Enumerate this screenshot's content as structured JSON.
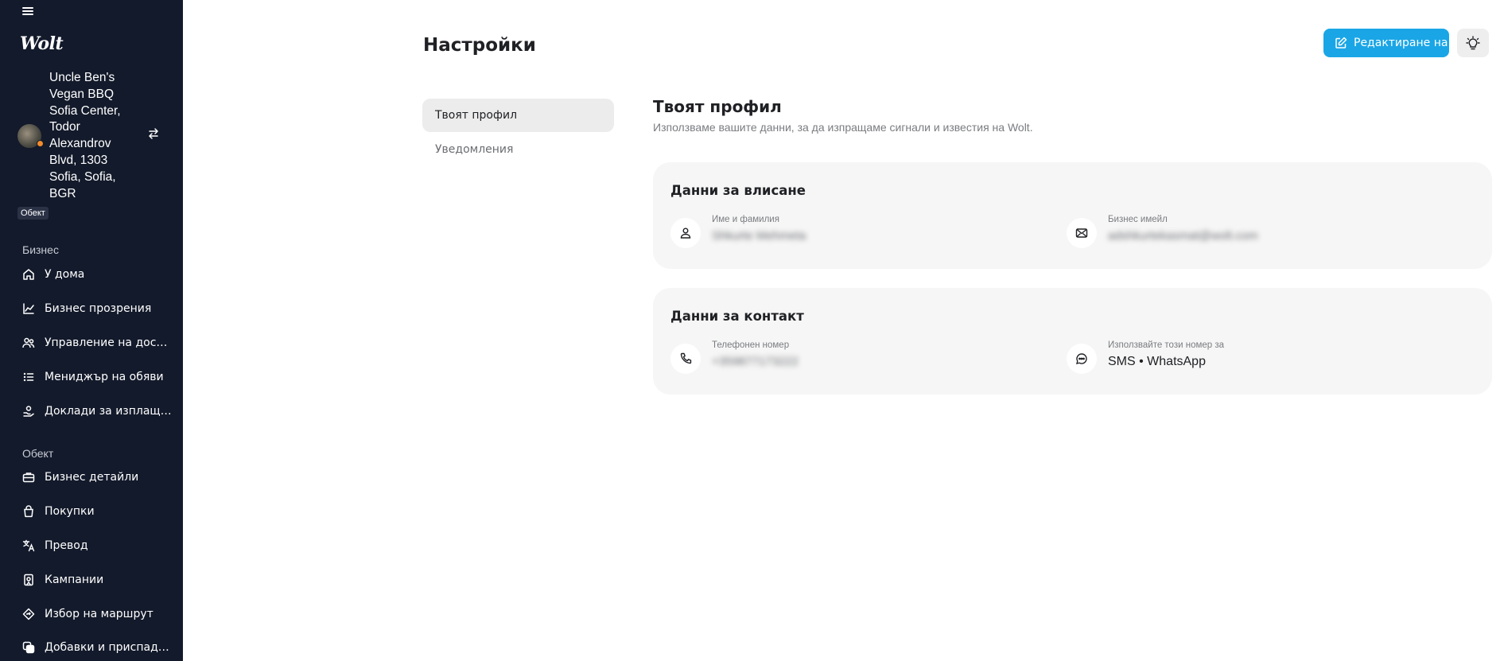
{
  "sidebar": {
    "logo": "Wolt",
    "venue": {
      "name": "Uncle Ben's Vegan BBQ Sofia Center, Todor Alexandrov Blvd, 1303 Sofia, Sofia, BGR",
      "badge": "Обект"
    },
    "sections": [
      {
        "label": "Бизнес",
        "items": [
          {
            "label": "У дома",
            "icon": "home-icon"
          },
          {
            "label": "Бизнес прозрения",
            "icon": "chart-line-icon"
          },
          {
            "label": "Управление на дост...",
            "icon": "users-icon"
          },
          {
            "label": "Мениджър на обяви",
            "icon": "list-icon"
          },
          {
            "label": "Доклади за изплаща...",
            "icon": "payout-icon"
          }
        ]
      },
      {
        "label": "Обект",
        "items": [
          {
            "label": "Бизнес детайли",
            "icon": "briefcase-icon"
          },
          {
            "label": "Покупки",
            "icon": "shopping-bag-icon"
          },
          {
            "label": "Превод",
            "icon": "translate-icon"
          },
          {
            "label": "Кампании",
            "icon": "campaign-icon"
          },
          {
            "label": "Избор на маршрут",
            "icon": "route-icon"
          },
          {
            "label": "Добавки и приспада...",
            "icon": "addons-icon"
          }
        ]
      }
    ]
  },
  "header": {
    "title": "Настройки",
    "edit_button": "Редактиране на"
  },
  "subnav": [
    {
      "label": "Твоят профил",
      "active": true
    },
    {
      "label": "Уведомления",
      "active": false
    }
  ],
  "profile": {
    "title": "Твоят профил",
    "description": "Използваме вашите данни, за да изпращаме сигнали и известия на Wolt.",
    "login_card": {
      "title": "Данни за влисане",
      "name_label": "Име и фамилия",
      "name_value": "Shkurte Mehmeta",
      "email_label": "Бизнес имейл",
      "email_value": "adshkurtekasmat@wolt.com"
    },
    "contact_card": {
      "title": "Данни за контакт",
      "phone_label": "Телефонен номер",
      "phone_value": "+359877173222",
      "usage_label": "Използвайте този номер за",
      "usage_value": "SMS • WhatsApp"
    }
  },
  "colors": {
    "sidebar_bg": "#131a2b",
    "accent": "#1aa6e6",
    "status_dot": "#f28b2c",
    "card_bg": "#f6f6f6"
  }
}
